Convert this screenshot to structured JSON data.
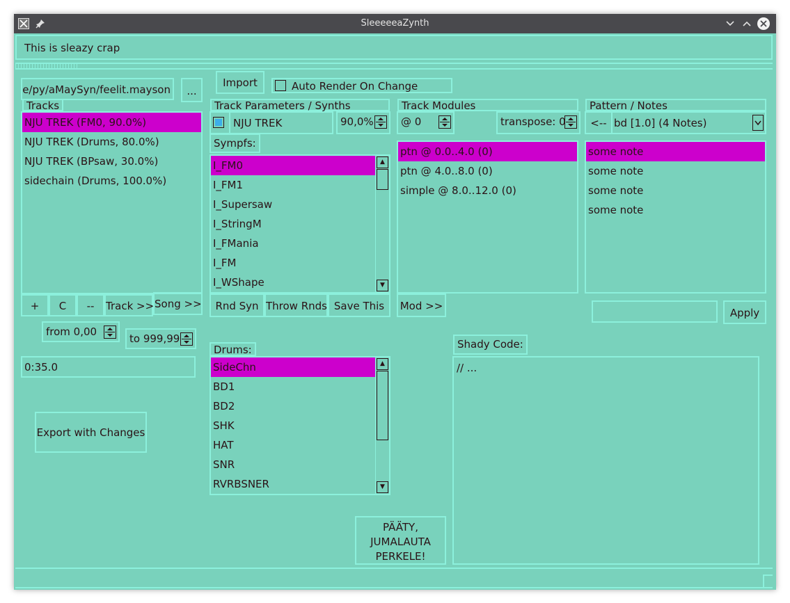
{
  "window": {
    "title": "SleeeeeaZynth"
  },
  "header_text": "This is sleazy crap",
  "file": {
    "path": "rze/py/aMaySyn/feelit.mayson",
    "browse_label": "..."
  },
  "toolbar": {
    "import_label": "Import",
    "auto_render_label": "Auto Render On Change",
    "auto_render_checked": false
  },
  "tracks": {
    "label": "Tracks",
    "items": [
      {
        "label": "NJU TREK (FM0, 90.0%)",
        "selected": true
      },
      {
        "label": "NJU TREK (Drums, 80.0%)",
        "selected": false
      },
      {
        "label": "NJU TREK (BPsaw, 30.0%)",
        "selected": false
      },
      {
        "label": "sidechain (Drums, 100.0%)",
        "selected": false
      }
    ],
    "buttons": {
      "add": "+",
      "clone": "C",
      "remove": "--",
      "track": "Track >>",
      "song": "Song >>"
    },
    "from_value": "from 0,00",
    "to_value": "to 999,99",
    "time": "0:35.0",
    "export_label": "Export with Changes"
  },
  "track_params": {
    "label": "Track Parameters / Synths",
    "track_name": "NJU TREK",
    "volume": "90,0%",
    "sympfs_label": "Sympfs:",
    "synths": [
      {
        "label": "I_FM0",
        "selected": true
      },
      {
        "label": "I_FM1",
        "selected": false
      },
      {
        "label": "I_Supersaw",
        "selected": false
      },
      {
        "label": "I_StringM",
        "selected": false
      },
      {
        "label": "I_FMania",
        "selected": false
      },
      {
        "label": "I_FM",
        "selected": false
      },
      {
        "label": "I_WShape",
        "selected": false
      }
    ],
    "buttons": {
      "rnd_syn": "Rnd Syn",
      "throw_rnds": "Throw Rnds",
      "save_this": "Save This"
    },
    "drums_label": "Drums:",
    "drums": [
      {
        "label": "SideChn",
        "selected": true
      },
      {
        "label": "BD1",
        "selected": false
      },
      {
        "label": "BD2",
        "selected": false
      },
      {
        "label": "SHK",
        "selected": false
      },
      {
        "label": "HAT",
        "selected": false
      },
      {
        "label": "SNR",
        "selected": false
      },
      {
        "label": "RVRBSNER",
        "selected": false
      }
    ],
    "paty_label": "PÄÄTY,\nJUMALAUTA\nPERKELE!"
  },
  "track_modules": {
    "label": "Track Modules",
    "position": "@ 0",
    "transpose": "transpose: 0",
    "items": [
      {
        "label": "ptn @ 0.0..4.0 (0)",
        "selected": true
      },
      {
        "label": "ptn @ 4.0..8.0 (0)",
        "selected": false
      },
      {
        "label": "simple @ 8.0..12.0 (0)",
        "selected": false
      }
    ],
    "mod_button": "Mod >>"
  },
  "pattern": {
    "label": "Pattern / Notes",
    "back_label": "<--",
    "selected_pattern": "bd [1.0] (4 Notes)",
    "notes": [
      {
        "label": "some note",
        "selected": true
      },
      {
        "label": "some note",
        "selected": false
      },
      {
        "label": "some note",
        "selected": false
      },
      {
        "label": "some note",
        "selected": false
      }
    ],
    "input_value": "",
    "apply_label": "Apply"
  },
  "shader": {
    "label": "Shady Code:",
    "code": "// ..."
  },
  "colors": {
    "background": "#79d2bc",
    "border": "#8cf0dc",
    "selection": "#cc00cc",
    "text": "#2a1216",
    "checkbox_checked": "#3daee9"
  }
}
